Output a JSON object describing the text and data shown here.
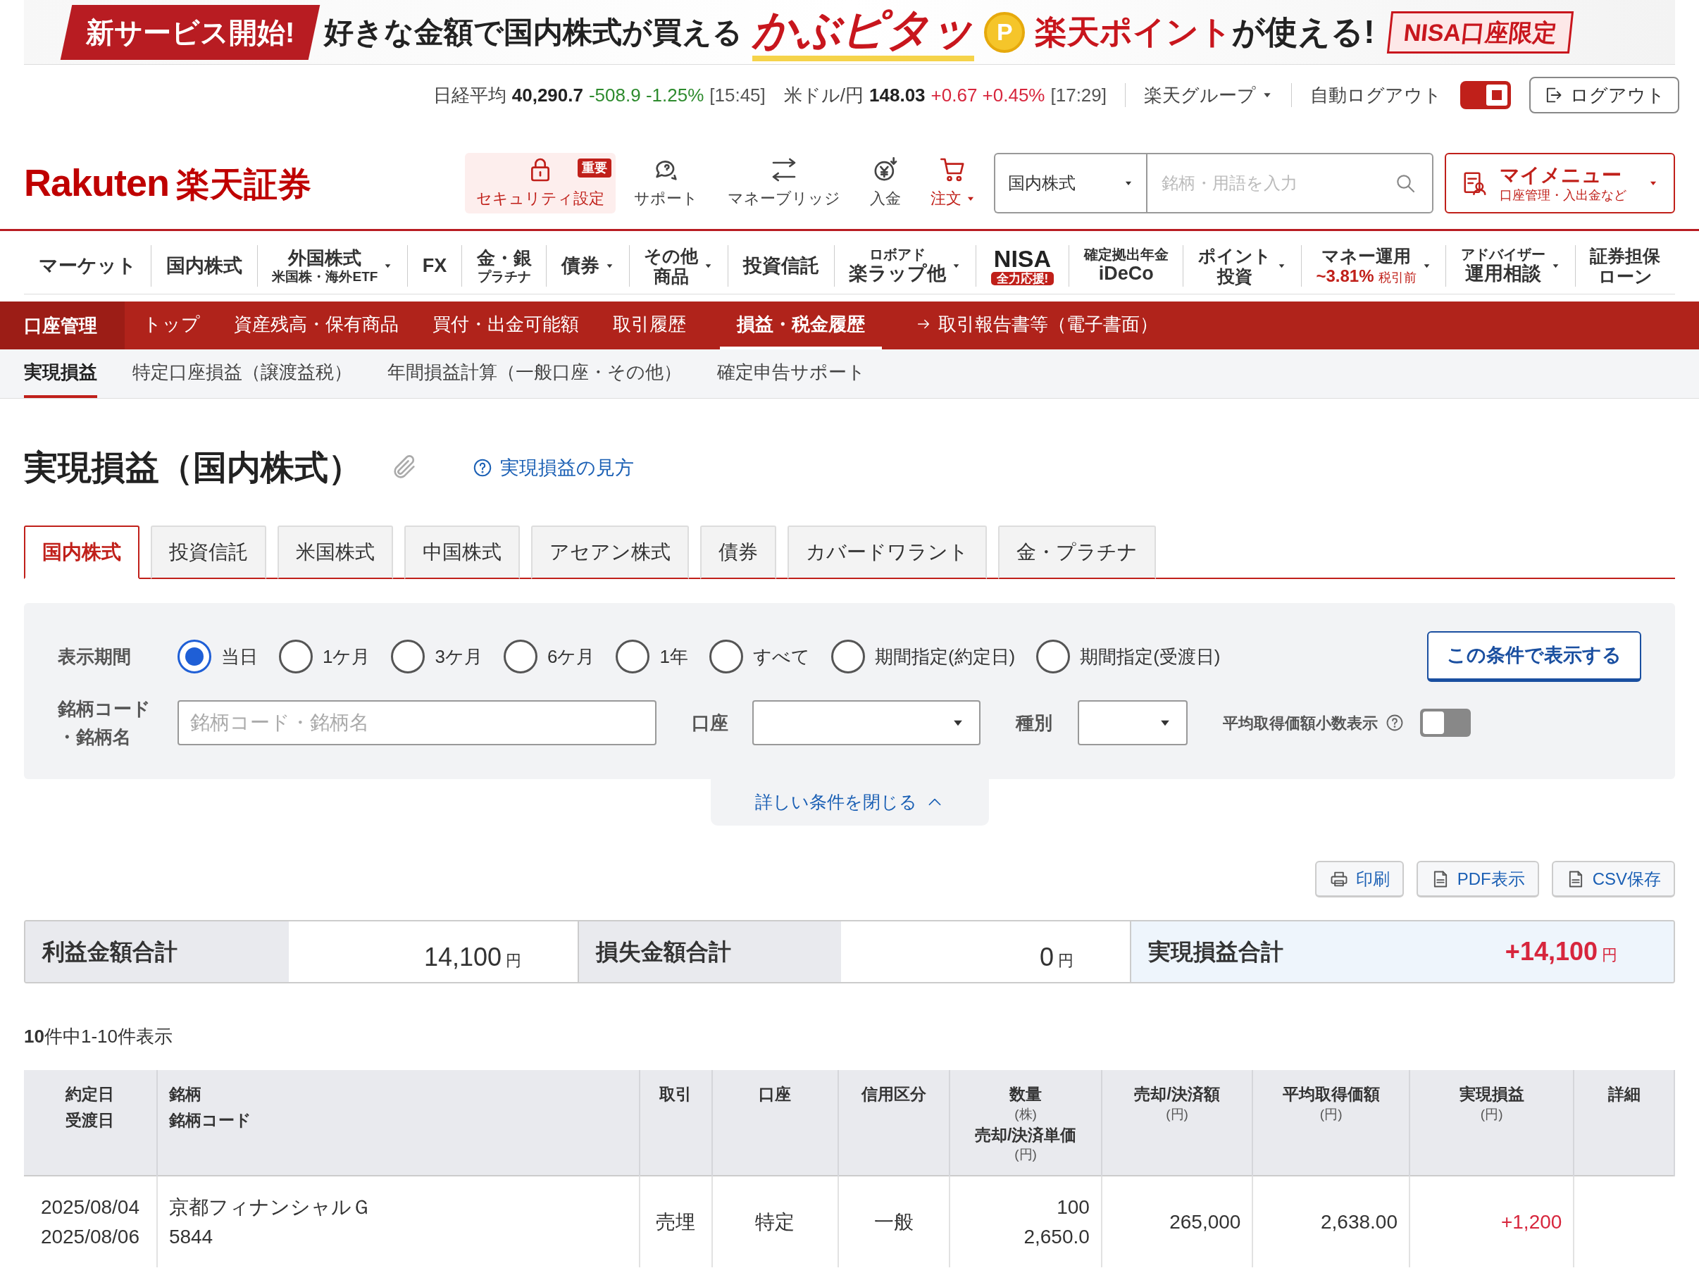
{
  "banner": {
    "badge": "新サービス開始!",
    "headline": "好きな金額で国内株式が買える",
    "brand": "かぶピタッ",
    "coin": "P",
    "points": "楽天ポイント",
    "points_suffix": "が使える!",
    "tag": "NISA口座限定"
  },
  "market_bar": {
    "indices": [
      {
        "label": "日経平均",
        "value": "40,290.7",
        "change": "-508.9 -1.25%",
        "time": "[15:45]",
        "color": "#2e8b2e"
      },
      {
        "label": "米ドル/円",
        "value": "148.03",
        "change": "+0.67 +0.45%",
        "time": "[17:29]",
        "color": "#d7263d"
      }
    ],
    "group_menu": "楽天グループ",
    "auto_logout": {
      "label": "自動ログアウト",
      "on": true
    },
    "logout": "ログアウト"
  },
  "header": {
    "logo_en": "Rakuten",
    "logo_ja": "楽天証券",
    "tools": [
      {
        "label": "セキュリティ設定",
        "kind": "lock",
        "highlighted": true,
        "badge": "重要",
        "accent": true,
        "caret": false
      },
      {
        "label": "サポート",
        "kind": "chat",
        "highlighted": false,
        "accent": false,
        "caret": false
      },
      {
        "label": "マネーブリッジ",
        "kind": "bank",
        "highlighted": false,
        "accent": false,
        "caret": false
      },
      {
        "label": "入金",
        "kind": "yen",
        "highlighted": false,
        "accent": false,
        "caret": false
      },
      {
        "label": "注文",
        "kind": "cart",
        "highlighted": false,
        "accent": true,
        "caret": true
      }
    ],
    "search": {
      "category": "国内株式",
      "placeholder": "銘柄・用語を入力"
    },
    "my_menu": {
      "title": "マイメニュー",
      "subtitle": "口座管理・入出金など"
    }
  },
  "main_nav": [
    {
      "kind": "plain",
      "lines": [
        "マーケット"
      ],
      "caret": false
    },
    {
      "kind": "plain",
      "lines": [
        "国内株式"
      ],
      "caret": false
    },
    {
      "kind": "sub",
      "lines": [
        "外国株式",
        "米国株・海外ETF"
      ],
      "caret": true
    },
    {
      "kind": "plain",
      "lines": [
        "FX"
      ],
      "caret": false
    },
    {
      "kind": "sub",
      "lines": [
        "金・銀",
        "プラチナ"
      ],
      "caret": false
    },
    {
      "kind": "plain",
      "lines": [
        "債券"
      ],
      "caret": true
    },
    {
      "kind": "two",
      "lines": [
        "その他",
        "商品"
      ],
      "caret": true
    },
    {
      "kind": "plain",
      "lines": [
        "投資信託"
      ],
      "caret": false
    },
    {
      "kind": "pre",
      "lines": [
        "ロボアド",
        "楽ラップ他"
      ],
      "caret": true
    },
    {
      "kind": "badge",
      "lines": [
        "NISA",
        "全力応援!"
      ],
      "caret": false
    },
    {
      "kind": "pre",
      "lines": [
        "確定拠出年金",
        "iDeCo"
      ],
      "caret": false
    },
    {
      "kind": "two",
      "lines": [
        "ポイント",
        "投資"
      ],
      "caret": true
    },
    {
      "kind": "rate",
      "lines": [
        "マネー運用",
        "~3.81%",
        "税引前"
      ],
      "caret": true
    },
    {
      "kind": "pre",
      "lines": [
        "アドバイザー",
        "運用相談"
      ],
      "caret": true
    },
    {
      "kind": "two",
      "lines": [
        "証券担保",
        "ローン"
      ],
      "caret": false
    }
  ],
  "account_nav": {
    "title": "口座管理",
    "items": [
      {
        "label": "トップ",
        "selected": false,
        "kind": "link"
      },
      {
        "label": "資産残高・保有商品",
        "selected": false,
        "kind": "link"
      },
      {
        "label": "買付・出金可能額",
        "selected": false,
        "kind": "link"
      },
      {
        "label": "取引履歴",
        "selected": false,
        "kind": "link"
      },
      {
        "label": "損益・税金履歴",
        "selected": true,
        "kind": "link"
      },
      {
        "label": "取引報告書等（電子書面）",
        "selected": false,
        "kind": "external"
      }
    ]
  },
  "sub_tabs": [
    {
      "label": "実現損益",
      "selected": true
    },
    {
      "label": "特定口座損益（譲渡益税）",
      "selected": false
    },
    {
      "label": "年間損益計算（一般口座・その他）",
      "selected": false
    },
    {
      "label": "確定申告サポート",
      "selected": false
    }
  ],
  "page": {
    "title": "実現損益（国内株式）",
    "help_link": "実現損益の見方"
  },
  "asset_tabs": [
    {
      "label": "国内株式",
      "selected": true
    },
    {
      "label": "投資信託",
      "selected": false
    },
    {
      "label": "米国株式",
      "selected": false
    },
    {
      "label": "中国株式",
      "selected": false
    },
    {
      "label": "アセアン株式",
      "selected": false
    },
    {
      "label": "債券",
      "selected": false
    },
    {
      "label": "カバードワラント",
      "selected": false
    },
    {
      "label": "金・プラチナ",
      "selected": false
    }
  ],
  "filter": {
    "period_label": "表示期間",
    "periods": [
      {
        "label": "当日",
        "selected": true
      },
      {
        "label": "1ケ月",
        "selected": false
      },
      {
        "label": "3ケ月",
        "selected": false
      },
      {
        "label": "6ケ月",
        "selected": false
      },
      {
        "label": "1年",
        "selected": false
      },
      {
        "label": "すべて",
        "selected": false
      },
      {
        "label": "期間指定(約定日)",
        "selected": false
      },
      {
        "label": "期間指定(受渡日)",
        "selected": false
      }
    ],
    "submit": "この条件で表示する",
    "code_label": [
      "銘柄コード",
      "・銘柄名"
    ],
    "code_placeholder": "銘柄コード・銘柄名",
    "account_label": "口座",
    "type_label": "種別",
    "decimal_label": "平均取得価額小数表示",
    "decimal_on": false,
    "collapse": "詳しい条件を閉じる"
  },
  "actions": [
    {
      "label": "印刷",
      "kind": "print"
    },
    {
      "label": "PDF表示",
      "kind": "pdf"
    },
    {
      "label": "CSV保存",
      "kind": "csv"
    }
  ],
  "summary": [
    {
      "label": "利益金額合計",
      "value": "14,100",
      "unit": "円",
      "kind": "plain"
    },
    {
      "label": "損失金額合計",
      "value": "0",
      "unit": "円",
      "kind": "plain"
    },
    {
      "label": "実現損益合計",
      "value": "+14,100",
      "unit": "円",
      "kind": "total"
    }
  ],
  "count": "**10**件中1-10件表示",
  "table": {
    "columns": [
      {
        "parts": [
          {
            "text": "約定日",
            "kind": "label"
          },
          {
            "text": "受渡日",
            "kind": "label"
          }
        ]
      },
      {
        "parts": [
          {
            "text": "銘柄",
            "kind": "label"
          },
          {
            "text": "銘柄コード",
            "kind": "label"
          }
        ]
      },
      {
        "parts": [
          {
            "text": "取引",
            "kind": "label"
          }
        ]
      },
      {
        "parts": [
          {
            "text": "口座",
            "kind": "label"
          }
        ]
      },
      {
        "parts": [
          {
            "text": "信用区分",
            "kind": "label"
          }
        ]
      },
      {
        "parts": [
          {
            "text": "数量",
            "kind": "label"
          },
          {
            "text": "(株)",
            "kind": "unit"
          },
          {
            "text": "売却/決済単価",
            "kind": "label"
          },
          {
            "text": "(円)",
            "kind": "unit"
          }
        ]
      },
      {
        "parts": [
          {
            "text": "売却/決済額",
            "kind": "label"
          },
          {
            "text": "(円)",
            "kind": "unit"
          }
        ]
      },
      {
        "parts": [
          {
            "text": "平均取得価額",
            "kind": "label"
          },
          {
            "text": "(円)",
            "kind": "unit"
          }
        ]
      },
      {
        "parts": [
          {
            "text": "実現損益",
            "kind": "label"
          },
          {
            "text": "(円)",
            "kind": "unit"
          }
        ]
      },
      {
        "parts": [
          {
            "text": "詳細",
            "kind": "label"
          }
        ]
      }
    ],
    "rows": [
      {
        "trade_date": "2025/08/04",
        "delivery_date": "2025/08/06",
        "name": "京都フィナンシャルＧ",
        "code": "5844",
        "trade": "売埋",
        "account": "特定",
        "margin": "一般",
        "quantity": "100",
        "unit_price": "2,650.0",
        "amount": "265,000",
        "avg_cost": "2,638.00",
        "pnl": "+1,200",
        "color": "#d7263d"
      }
    ]
  }
}
